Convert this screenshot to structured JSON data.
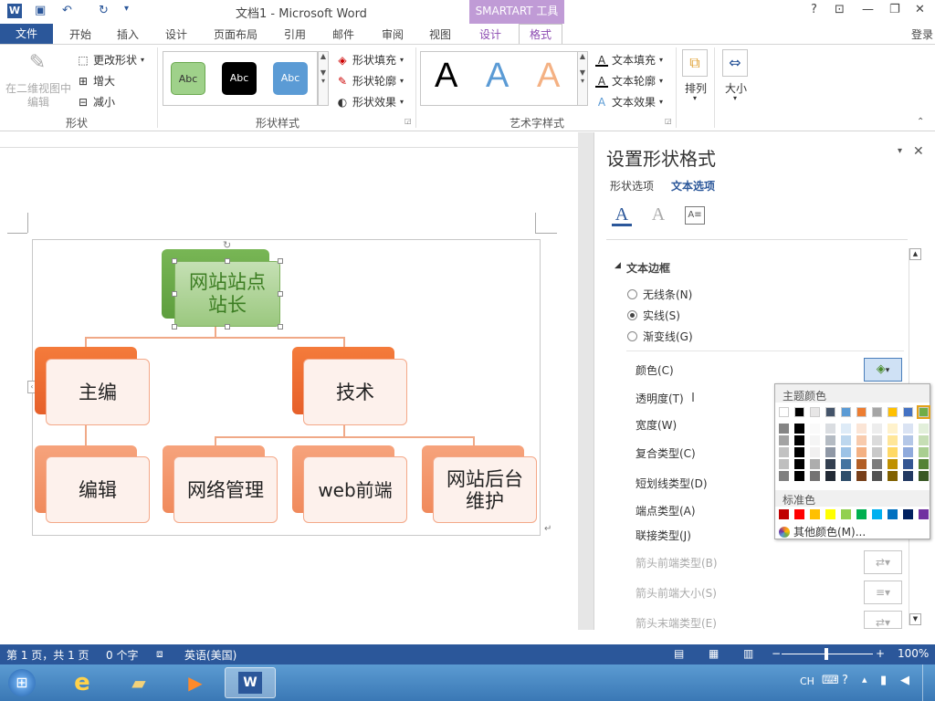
{
  "titlebar": {
    "title": "文档1 - Microsoft Word",
    "smartart_tools": "SMARTART 工具",
    "help": "?",
    "qa_undo": "↶",
    "qa_redo": "↻"
  },
  "tabs": {
    "file": "文件",
    "items": [
      "开始",
      "插入",
      "设计",
      "页面布局",
      "引用",
      "邮件",
      "审阅",
      "视图",
      "设计"
    ],
    "format": "格式",
    "login": "登录"
  },
  "ribbon": {
    "shape_group": {
      "edit_2d": "在二维视图中编辑",
      "change_shape": "更改形状",
      "larger": "增大",
      "smaller": "减小",
      "label": "形状"
    },
    "shape_styles": {
      "styles": [
        "Abc",
        "Abc",
        "Abc"
      ],
      "fill": "形状填充",
      "outline": "形状轮廓",
      "effects": "形状效果",
      "label": "形状样式"
    },
    "wordart": {
      "letter": "A",
      "fill": "文本填充",
      "outline": "文本轮廓",
      "effects": "文本效果",
      "label": "艺术字样式"
    },
    "arrange": "排列",
    "size": "大小"
  },
  "diagram": {
    "top": "网站站点站长",
    "top_line1": "网站站点",
    "top_line2": "站长",
    "level2": [
      "主编",
      "技术"
    ],
    "level3": [
      "编辑",
      "网络管理",
      "web前端",
      "网站后台维护"
    ],
    "level3_last_line1": "网站后台",
    "level3_last_line2": "维护"
  },
  "pane": {
    "title": "设置形状格式",
    "tab_shape": "形状选项",
    "tab_text": "文本选项",
    "section": "文本边框",
    "radio_none": "无线条(N)",
    "radio_solid": "实线(S)",
    "radio_gradient": "渐变线(G)",
    "color": "颜色(C)",
    "transparency": "透明度(T)",
    "width": "宽度(W)",
    "compound": "复合类型(C)",
    "dash": "短划线类型(D)",
    "cap": "端点类型(A)",
    "join": "联接类型(J)",
    "arrow_begin_type": "箭头前端类型(B)",
    "arrow_begin_size": "箭头前端大小(S)",
    "arrow_end_type": "箭头末端类型(E)"
  },
  "colorpop": {
    "theme_label": "主题颜色",
    "standard_label": "标准色",
    "more": "其他颜色(M)...",
    "theme_top": [
      "#ffffff",
      "#000000",
      "#e7e6e6",
      "#44546a",
      "#5b9bd5",
      "#ed7d31",
      "#a5a5a5",
      "#ffc000",
      "#4472c4",
      "#70ad47"
    ],
    "standard": [
      "#c00000",
      "#ff0000",
      "#ffc000",
      "#ffff00",
      "#92d050",
      "#00b050",
      "#00b0f0",
      "#0070c0",
      "#002060",
      "#7030a0"
    ]
  },
  "status": {
    "page": "第 1 页，共 1 页",
    "words": "0 个字",
    "lang": "英语(美国)",
    "zoom": "100%"
  },
  "taskbar": {
    "ime": "CH"
  }
}
